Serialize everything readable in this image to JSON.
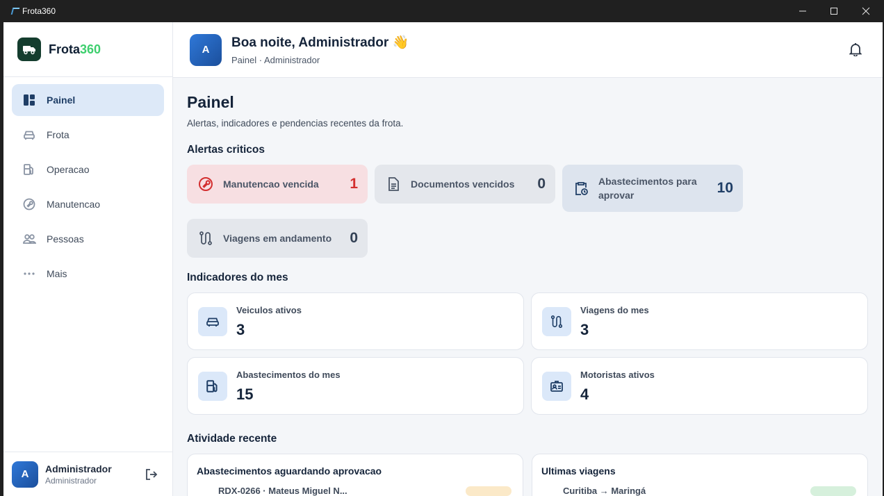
{
  "window": {
    "title": "Frota360"
  },
  "brand": {
    "name_main": "Frota",
    "name_accent": "360"
  },
  "sidebar": {
    "items": [
      {
        "label": "Painel",
        "icon": "dashboard-icon",
        "active": true
      },
      {
        "label": "Frota",
        "icon": "car-icon",
        "active": false
      },
      {
        "label": "Operacao",
        "icon": "fuel-icon",
        "active": false
      },
      {
        "label": "Manutencao",
        "icon": "wrench-icon",
        "active": false
      },
      {
        "label": "Pessoas",
        "icon": "people-icon",
        "active": false
      },
      {
        "label": "Mais",
        "icon": "more-icon",
        "active": false
      }
    ]
  },
  "user": {
    "initial": "A",
    "name": "Administrador",
    "role": "Administrador"
  },
  "header": {
    "initial": "A",
    "greeting": "Boa noite, Administrador 👋",
    "breadcrumb": "Painel · Administrador"
  },
  "page": {
    "title": "Painel",
    "subtitle": "Alertas, indicadores e pendencias recentes da frota."
  },
  "alerts": {
    "title": "Alertas criticos",
    "items": [
      {
        "label": "Manutencao vencida",
        "count": "1",
        "icon": "wrench-alert-icon",
        "color": "#d32f2f"
      },
      {
        "label": "Documentos vencidos",
        "count": "0",
        "icon": "document-icon",
        "color": "#334155"
      },
      {
        "label": "Abastecimentos para aprovar",
        "count": "10",
        "icon": "clipboard-clock-icon",
        "color": "#1f3e66"
      },
      {
        "label": "Viagens em andamento",
        "count": "0",
        "icon": "route-icon",
        "color": "#334155"
      }
    ]
  },
  "indicators": {
    "title": "Indicadores do mes",
    "items": [
      {
        "label": "Veiculos ativos",
        "value": "3",
        "icon": "car-icon"
      },
      {
        "label": "Viagens do mes",
        "value": "3",
        "icon": "route-icon"
      },
      {
        "label": "Abastecimentos do mes",
        "value": "15",
        "icon": "fuel-icon"
      },
      {
        "label": "Motoristas ativos",
        "value": "4",
        "icon": "id-card-icon"
      }
    ]
  },
  "recent": {
    "title": "Atividade recente",
    "cards": [
      {
        "title": "Abastecimentos aguardando aprovacao",
        "first_line": "RDX-0266 · Mateus Miguel N..."
      },
      {
        "title": "Ultimas viagens",
        "first_line": "Curitiba → Maringá"
      }
    ]
  }
}
